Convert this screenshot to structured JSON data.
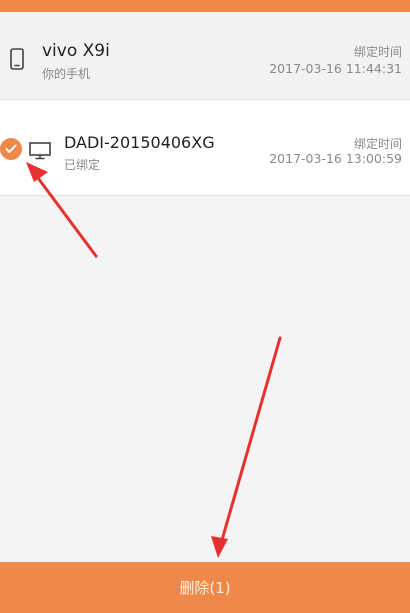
{
  "theme": {
    "accent": "#f0884a",
    "annotation_arrow": "#e8312f"
  },
  "devices": [
    {
      "name": "vivo X9i",
      "status": "你的手机",
      "bind_label": "绑定时间",
      "bind_time": "2017-03-16 11:44:31",
      "icon": "phone-icon",
      "selected": false
    },
    {
      "name": "DADI-20150406XG",
      "status": "已绑定",
      "bind_label": "绑定时间",
      "bind_time": "2017-03-16 13:00:59",
      "icon": "monitor-icon",
      "selected": true
    }
  ],
  "footer": {
    "delete_label": "删除(1)"
  }
}
